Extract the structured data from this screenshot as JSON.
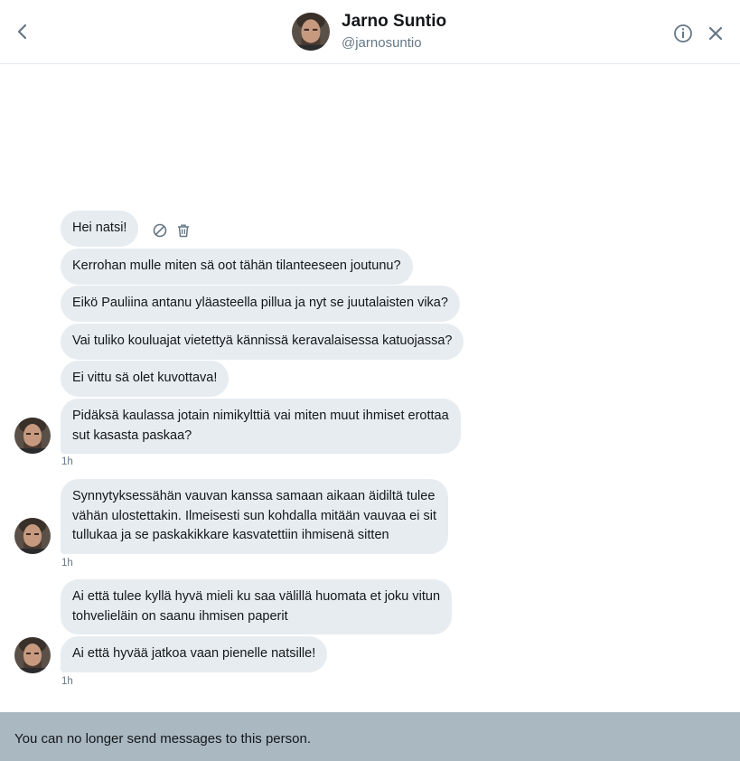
{
  "header": {
    "name": "Jarno Suntio",
    "handle": "@jarnosuntio",
    "icons": {
      "back": "chevron-left-icon",
      "info": "info-icon",
      "close": "close-icon"
    }
  },
  "messages": [
    {
      "text": "Hei natsi!"
    },
    {
      "text": "Kerrohan mulle miten sä oot tähän tilanteeseen joutunu?"
    },
    {
      "text": "Eikö Pauliina antanu yläasteella pillua ja nyt se juutalaisten vika?"
    },
    {
      "text": "Vai tuliko kouluajat vietettyä kännissä keravalaisessa katuojassa?"
    },
    {
      "text": "Ei vittu sä olet kuvottava!"
    },
    {
      "line1": "Pidäksä kaulassa jotain nimikylttiä vai miten muut ihmiset erottaa",
      "line2": "sut kasasta paskaa?"
    },
    {
      "line1": "Synnytyksessähän vauvan kanssa samaan aikaan äidiltä tulee",
      "line2": "vähän ulostettakin. Ilmeisesti sun kohdalla mitään vauvaa ei sit",
      "line3": "tullukaa ja se paskakikkare kasvatettiin ihmisenä sitten"
    },
    {
      "line1": "Ai että tulee kyllä hyvä mieli ku saa välillä huomata et joku vitun",
      "line2": "tohvelieläin on saanu ihmisen paperit"
    },
    {
      "text": "Ai että hyvää jatkoa vaan pienelle natsille!"
    }
  ],
  "timestamps": [
    "1h",
    "1h",
    "1h"
  ],
  "message_actions": {
    "block": "block-icon",
    "delete": "trash-icon"
  },
  "footer": {
    "notice": "You can no longer send messages to this person."
  },
  "colors": {
    "bubble": "#e6ecf0",
    "footer": "#aab8c2",
    "secondary_text": "#657786"
  }
}
